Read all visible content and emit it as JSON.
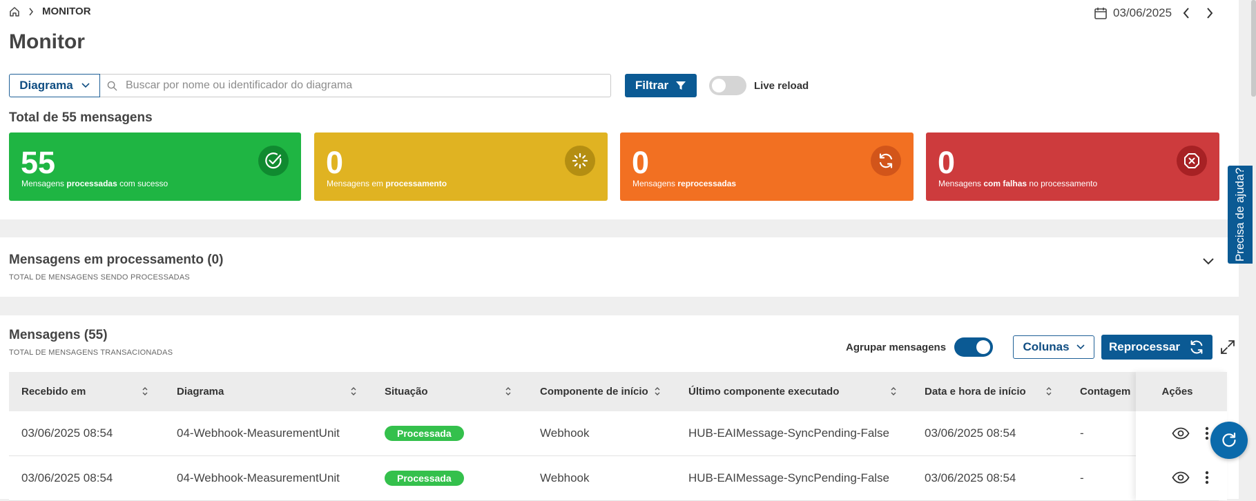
{
  "breadcrumb": {
    "current": "MONITOR"
  },
  "page": {
    "title": "Monitor"
  },
  "date_nav": {
    "date": "03/06/2025"
  },
  "filters": {
    "diagram_select": "Diagrama",
    "search_placeholder": "Buscar por nome ou identificador do diagrama",
    "filter_button": "Filtrar",
    "live_reload_label": "Live reload",
    "live_reload_on": false
  },
  "summary": {
    "total_label": "Total de 55 mensagens",
    "cards": [
      {
        "value": "55",
        "pre": "Mensagens ",
        "strong": "processadas",
        "post": " com sucesso",
        "color": "#1fb543",
        "icon": "check-circle-icon"
      },
      {
        "value": "0",
        "pre": "Mensagens em ",
        "strong": "processamento",
        "post": "",
        "color": "#e0b322",
        "icon": "spinner-icon"
      },
      {
        "value": "0",
        "pre": "Mensagens ",
        "strong": "reprocessadas",
        "post": "",
        "color": "#f27022",
        "icon": "refresh-icon"
      },
      {
        "value": "0",
        "pre": "Mensagens ",
        "strong": "com falhas",
        "post": " no processamento",
        "color": "#cd3b3d",
        "icon": "error-octagon-icon"
      }
    ]
  },
  "processing": {
    "title": "Mensagens em processamento (0)",
    "subtitle": "TOTAL DE MENSAGENS SENDO PROCESSADAS"
  },
  "messages": {
    "title": "Mensagens (55)",
    "subtitle": "TOTAL DE MENSAGENS TRANSACIONADAS",
    "group_label": "Agrupar mensagens",
    "group_on": true,
    "columns_button": "Colunas",
    "reprocess_button": "Reprocessar",
    "columns": [
      "Recebido em",
      "Diagrama",
      "Situação",
      "Componente de início",
      "Último componente executado",
      "Data e hora de início",
      "Contagem"
    ],
    "actions_header": "Ações",
    "rows": [
      {
        "received": "03/06/2025 08:54",
        "diagram": "04-Webhook-MeasurementUnit",
        "status": "Processada",
        "start_component": "Webhook",
        "last_component": "HUB-EAIMessage-SyncPending-False",
        "start_datetime": "03/06/2025 08:54",
        "count": "-"
      },
      {
        "received": "03/06/2025 08:54",
        "diagram": "04-Webhook-MeasurementUnit",
        "status": "Processada",
        "start_component": "Webhook",
        "last_component": "HUB-EAIMessage-SyncPending-False",
        "start_datetime": "03/06/2025 08:54",
        "count": "-"
      }
    ]
  },
  "help": {
    "label": "Precisa de ajuda?"
  },
  "colors": {
    "primary": "#0b5a94",
    "success_badge": "#34c04c"
  }
}
